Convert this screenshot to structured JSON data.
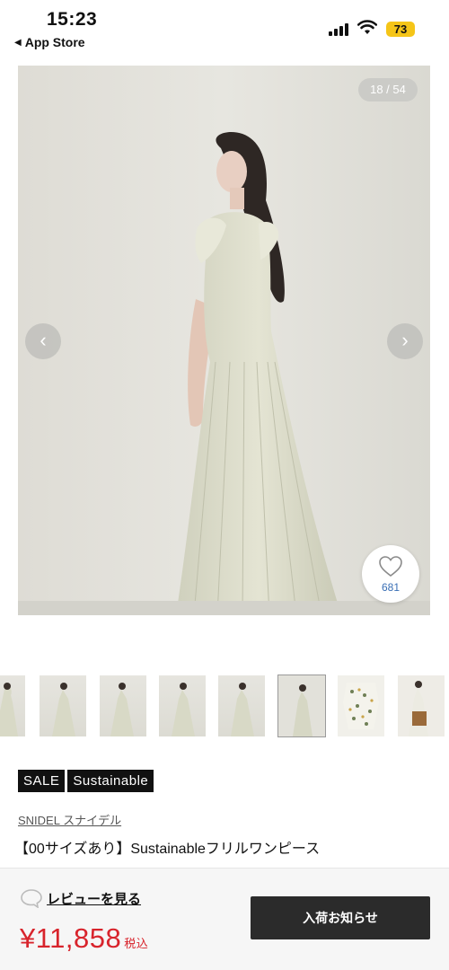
{
  "status_bar": {
    "time": "15:23",
    "back_label": "App Store",
    "battery": "73",
    "battery_color": "#f5c518"
  },
  "gallery": {
    "counter": "18 / 54",
    "prev_icon": "chevron-left-icon",
    "next_icon": "chevron-right-icon",
    "favorite_icon": "heart-icon",
    "favorite_count": "681",
    "thumbnail_count": 8,
    "active_thumbnail": 5
  },
  "product": {
    "badges": [
      "SALE",
      "Sustainable"
    ],
    "brand": "SNIDEL  スナイデル",
    "name": "【00サイズあり】Sustainableフリルワンピース"
  },
  "footer": {
    "review_icon": "speech-bubble-icon",
    "review_label": "レビューを見る",
    "price": "¥11,858",
    "tax_label": "税込",
    "notify_label": "入荷お知らせ",
    "price_color": "#d8242c"
  }
}
